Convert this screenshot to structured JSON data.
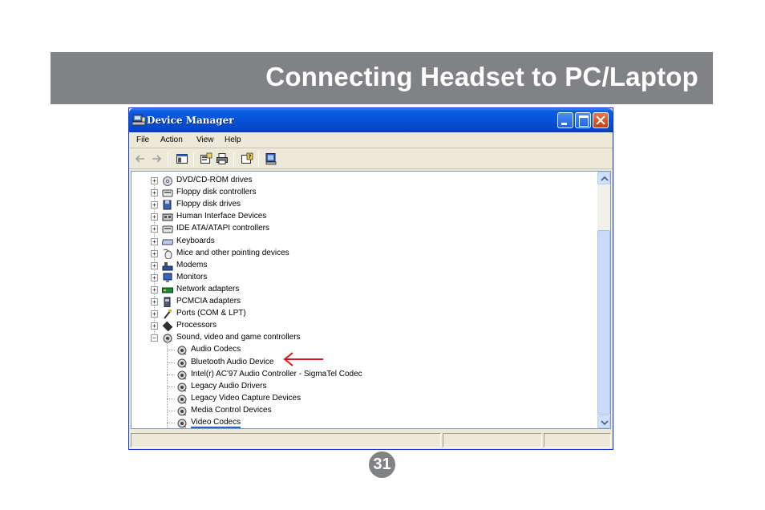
{
  "header": {
    "title": "Connecting Headset to PC/Laptop",
    "color": "#808285"
  },
  "window": {
    "title": "Device Manager",
    "menu": [
      "File",
      "Action",
      "View",
      "Help"
    ],
    "toolbar_icons": [
      "back-arrow-icon",
      "forward-arrow-icon",
      "show-hide-tree-icon",
      "properties-icon",
      "print-icon",
      "help-icon",
      "scan-hardware-icon"
    ]
  },
  "tree": {
    "categories": [
      {
        "label": "DVD/CD-ROM drives",
        "icon": "dvd-drive-icon",
        "expanded": false
      },
      {
        "label": "Floppy disk controllers",
        "icon": "disk-controller-icon",
        "expanded": false
      },
      {
        "label": "Floppy disk drives",
        "icon": "floppy-drive-icon",
        "expanded": false
      },
      {
        "label": "Human Interface Devices",
        "icon": "hid-icon",
        "expanded": false
      },
      {
        "label": "IDE ATA/ATAPI controllers",
        "icon": "ide-controller-icon",
        "expanded": false
      },
      {
        "label": "Keyboards",
        "icon": "keyboard-icon",
        "expanded": false
      },
      {
        "label": "Mice and other pointing devices",
        "icon": "mouse-icon",
        "expanded": false
      },
      {
        "label": "Modems",
        "icon": "modem-icon",
        "expanded": false
      },
      {
        "label": "Monitors",
        "icon": "monitor-icon",
        "expanded": false
      },
      {
        "label": "Network adapters",
        "icon": "network-adapter-icon",
        "expanded": false
      },
      {
        "label": "PCMCIA adapters",
        "icon": "pcmcia-icon",
        "expanded": false
      },
      {
        "label": "Ports (COM & LPT)",
        "icon": "port-icon",
        "expanded": false
      },
      {
        "label": "Processors",
        "icon": "processor-icon",
        "expanded": false
      },
      {
        "label": "Sound, video and game controllers",
        "icon": "sound-icon",
        "expanded": true
      }
    ],
    "sound_children": [
      "Audio Codecs",
      "Bluetooth Audio Device",
      "Intel(r) AC'97 Audio Controller - SigmaTel Codec",
      "Legacy Audio Drivers",
      "Legacy Video Capture Devices",
      "Media Control Devices",
      "Video Codecs"
    ],
    "highlighted_child": "Bluetooth Audio Device",
    "annotation_color": "#e0141e"
  },
  "page_number": "31"
}
